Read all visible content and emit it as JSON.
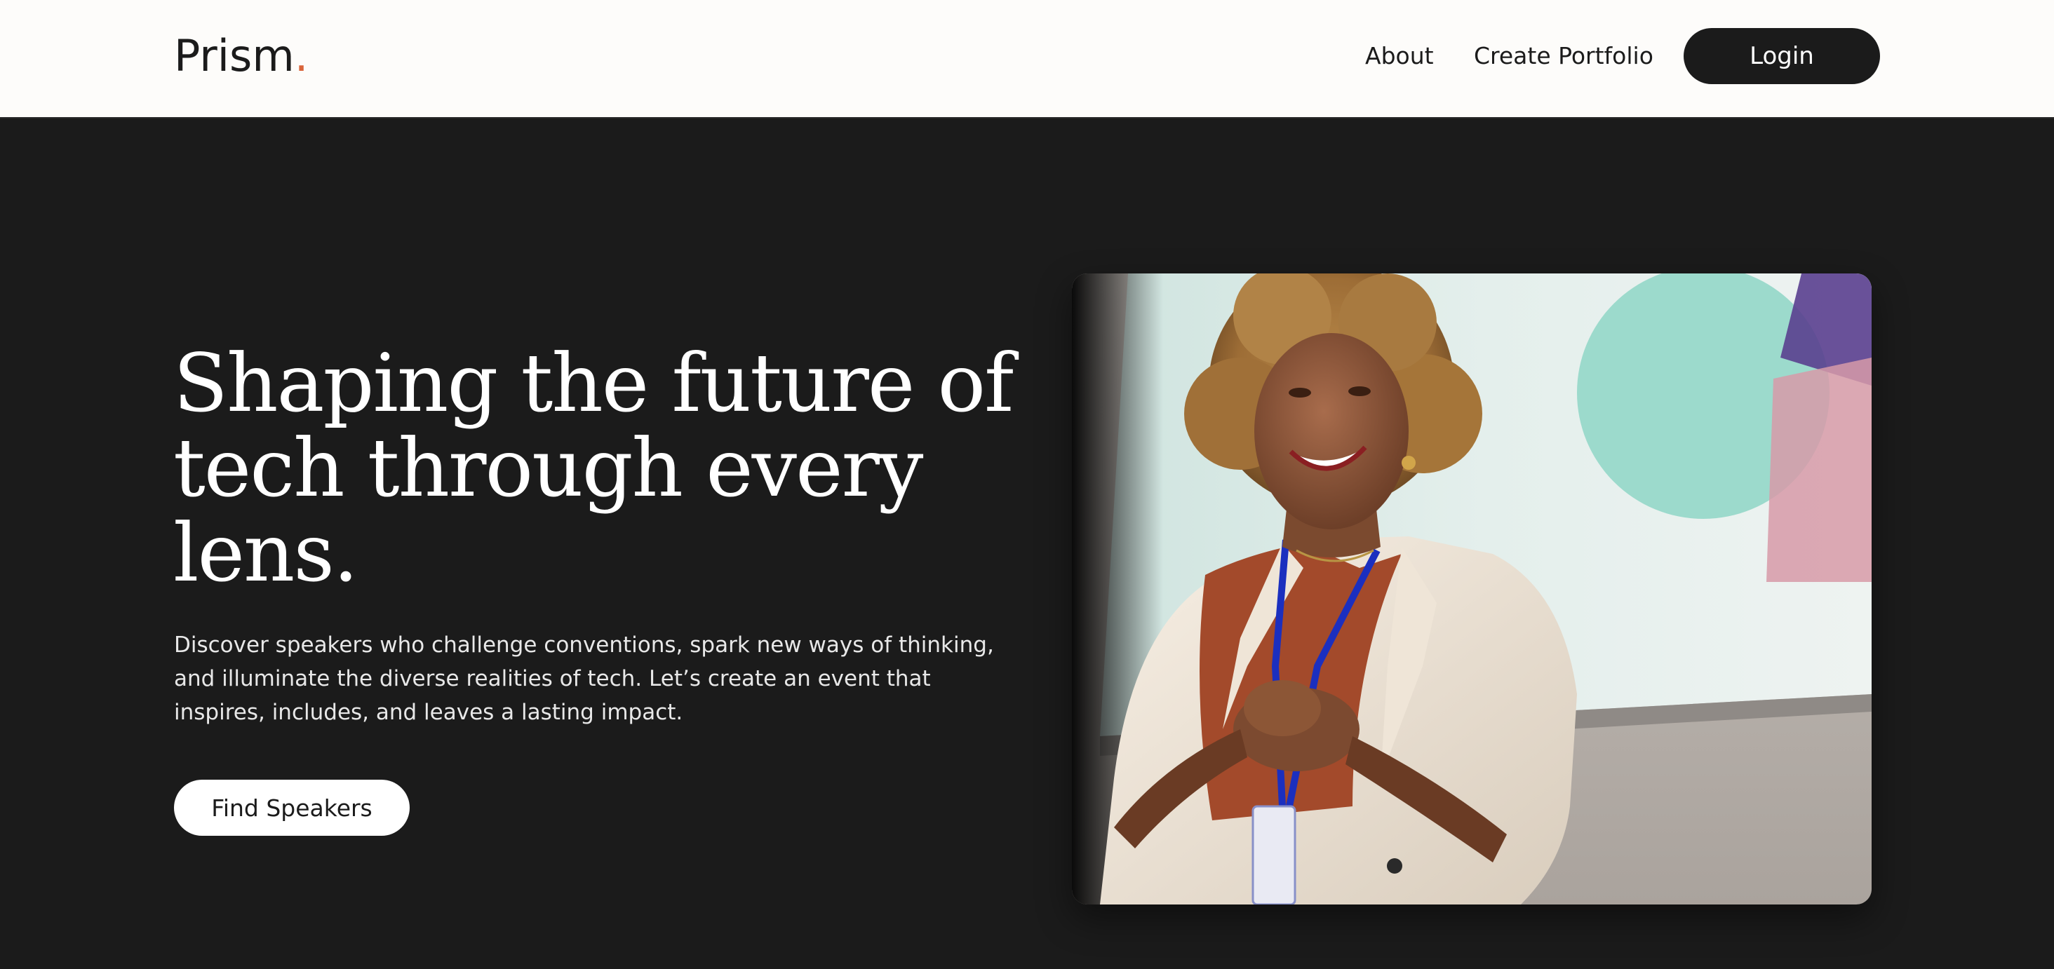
{
  "header": {
    "logo_text": "Prism",
    "logo_dot": ".",
    "nav": {
      "about": "About",
      "create_portfolio": "Create Portfolio"
    },
    "login_label": "Login"
  },
  "hero": {
    "title": "Shaping the future of tech through every lens.",
    "description": "Discover speakers who challenge conventions, spark new ways of thinking, and illuminate the diverse realities of tech. Let’s create an event that inspires, includes, and leaves a lasting impact.",
    "cta_label": "Find Speakers",
    "image": {
      "subject": "smiling-speaker-photo"
    }
  },
  "colors": {
    "background_dark": "#1b1b1b",
    "header_background": "#fdfcfa",
    "logo_accent": "#d9643a",
    "button_dark": "#1b1b1b",
    "button_light": "#ffffff"
  }
}
